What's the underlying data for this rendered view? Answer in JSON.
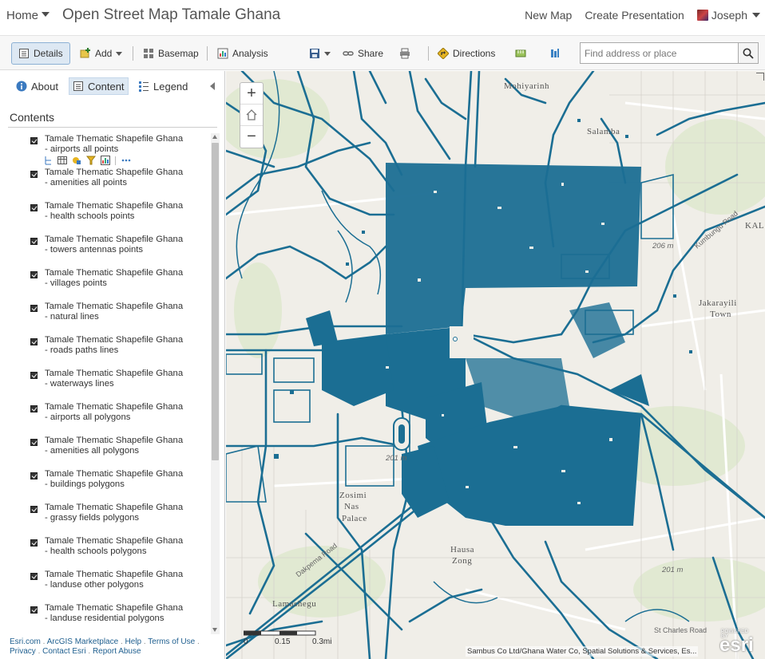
{
  "header": {
    "home_label": "Home",
    "map_title": "Open Street Map Tamale Ghana",
    "new_map": "New Map",
    "create_presentation": "Create Presentation",
    "user_name": "Joseph"
  },
  "toolbar": {
    "details": "Details",
    "add": "Add",
    "basemap": "Basemap",
    "analysis": "Analysis",
    "share": "Share",
    "directions": "Directions",
    "search_placeholder": "Find address or place"
  },
  "panel": {
    "tabs": {
      "about": "About",
      "content": "Content",
      "legend": "Legend"
    },
    "contents_heading": "Contents",
    "layers": [
      {
        "line1": "Tamale Thematic Shapefile Ghana",
        "line2": "- airports all points"
      },
      {
        "line1": "Tamale Thematic Shapefile Ghana",
        "line2": "- amenities all points"
      },
      {
        "line1": "Tamale Thematic Shapefile Ghana",
        "line2": "- health schools points"
      },
      {
        "line1": "Tamale Thematic Shapefile Ghana",
        "line2": "- towers antennas points"
      },
      {
        "line1": "Tamale Thematic Shapefile Ghana",
        "line2": "- villages points"
      },
      {
        "line1": "Tamale Thematic Shapefile Ghana",
        "line2": "- natural lines"
      },
      {
        "line1": "Tamale Thematic Shapefile Ghana",
        "line2": "- roads paths lines"
      },
      {
        "line1": "Tamale Thematic Shapefile Ghana",
        "line2": "- waterways lines"
      },
      {
        "line1": "Tamale Thematic Shapefile Ghana",
        "line2": "- airports all polygons"
      },
      {
        "line1": "Tamale Thematic Shapefile Ghana",
        "line2": "- amenities all polygons"
      },
      {
        "line1": "Tamale Thematic Shapefile Ghana",
        "line2": "- buildings polygons"
      },
      {
        "line1": "Tamale Thematic Shapefile Ghana",
        "line2": "- grassy fields polygons"
      },
      {
        "line1": "Tamale Thematic Shapefile Ghana",
        "line2": "- health schools polygons"
      },
      {
        "line1": "Tamale Thematic Shapefile Ghana",
        "line2": "- landuse other polygons"
      },
      {
        "line1": "Tamale Thematic Shapefile Ghana",
        "line2": "- landuse residential polygons"
      }
    ],
    "footer": {
      "esri_com": "Esri.com",
      "marketplace": "ArcGIS Marketplace",
      "help": "Help",
      "terms": "Terms of Use",
      "privacy": "Privacy",
      "contact": "Contact Esri",
      "report": "Report Abuse"
    }
  },
  "map": {
    "zoom_in": "+",
    "zoom_out": "−",
    "labels": {
      "mohiyarinh": "Mohiyarinh",
      "salamba": "Salamba",
      "kal": "KAL",
      "jakarayili": "Jakarayili",
      "town": "Town",
      "zosimi": "Zosimi",
      "nas": "Nas",
      "palace": "Palace",
      "hausa": "Hausa",
      "zong": "Zong",
      "lamashegu": "Lamashegu"
    },
    "elevations": {
      "e206": "206 m",
      "e201a": "201 m",
      "e201b": "201 m"
    },
    "roads": {
      "kumbungu": "Kumbungu Road",
      "dakpema": "Dakpema Road",
      "st_charles": "St Charles Road"
    },
    "scale": {
      "s0": "0",
      "s1": "0.15",
      "s2": "0.3mi"
    },
    "attribution": "Sambus Co Ltd/Ghana Water Co, Spatial Solutions & Services, Es...",
    "logo": "esri",
    "logo_small": "POWERED BY",
    "data_color": "#1b6e93"
  }
}
